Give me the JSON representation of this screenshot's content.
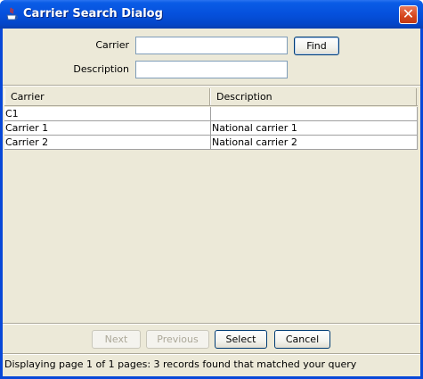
{
  "window": {
    "title": "Carrier Search Dialog",
    "close_glyph": "✕"
  },
  "form": {
    "carrier_label": "Carrier",
    "carrier_value": "",
    "description_label": "Description",
    "description_value": "",
    "find_label": "Find"
  },
  "table": {
    "columns": [
      "Carrier",
      "Description"
    ],
    "rows": [
      [
        "C1",
        ""
      ],
      [
        "Carrier 1",
        "National carrier 1"
      ],
      [
        "Carrier 2",
        "National carrier 2"
      ]
    ]
  },
  "buttons": {
    "next_label": "Next",
    "previous_label": "Previous",
    "select_label": "Select",
    "cancel_label": "Cancel"
  },
  "status": {
    "text": "Displaying page 1 of 1 pages:   3 records found that matched your query"
  },
  "colors": {
    "titlebar": "#0550dc",
    "dialog_bg": "#ece9d8",
    "close_button": "#d5451c"
  }
}
